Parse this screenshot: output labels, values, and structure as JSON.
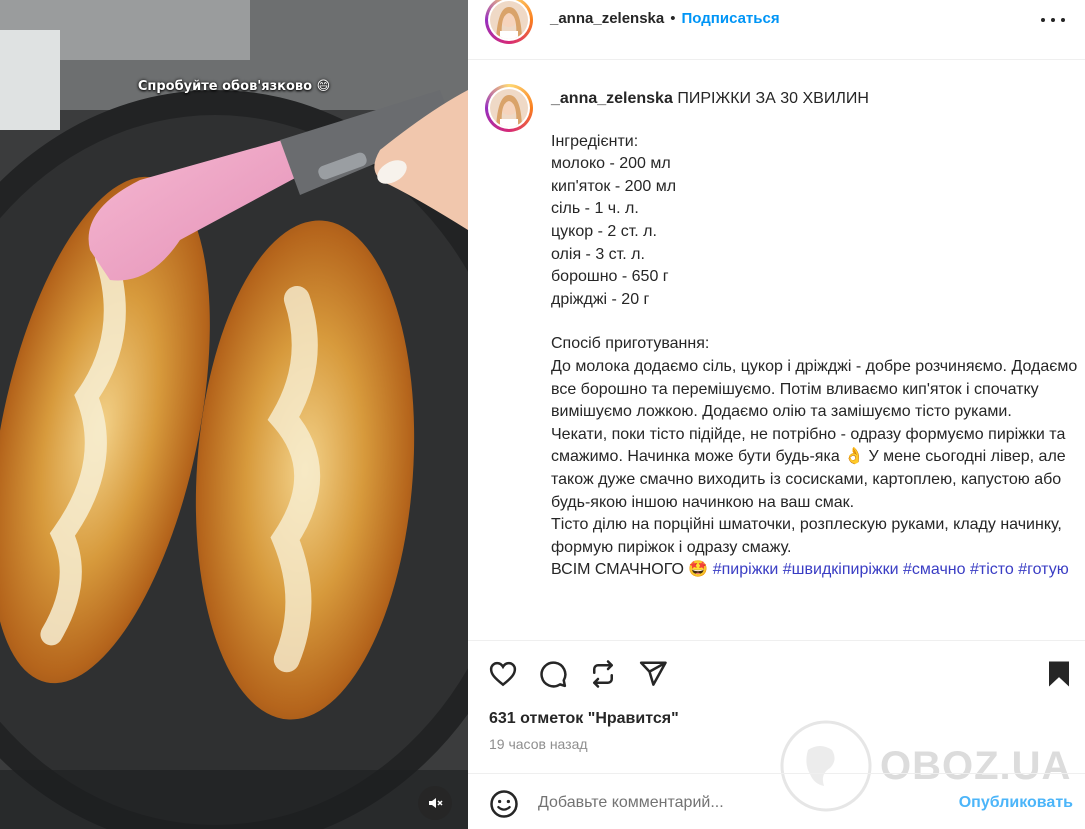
{
  "post": {
    "overlay_caption": "Спробуйте обов'язково 😄",
    "header": {
      "username": "_anna_zelenska",
      "separator": "•",
      "follow_label": "Подписаться"
    },
    "caption": {
      "username": "_anna_zelenska",
      "title": "ПИРІЖКИ ЗА 30 ХВИЛИН",
      "ingredients_heading": "Інгредієнти:",
      "ingredients": [
        "молоко - 200 мл",
        "кип'яток - 200 мл",
        "сіль - 1 ч. л.",
        "цукор - 2 ст. л.",
        "олія - 3 ст. л.",
        "борошно - 650 г",
        "дріжджі - 20 г"
      ],
      "method_heading": "Спосіб приготування:",
      "method": [
        "До молока додаємо сіль, цукор і дріжджі - добре розчиняємо. Додаємо все борошно та перемішуємо. Потім вливаємо кип'яток і спочатку вимішуємо ложкою. Додаємо олію та замішуємо тісто руками.",
        "Чекати, поки тісто підійде, не потрібно - одразу формуємо пиріжки та смажимо. Начинка може бути будь-яка 👌 У мене сьогодні лівер, але також дуже смачно виходить із сосисками, картоплею, капустою або будь-якою іншою начинкою на ваш смак.",
        "Тісто ділю на порційні шматочки, розплескую руками, кладу начинку, формую пиріжок і одразу смажу."
      ],
      "sign_off": "ВСІМ СМАЧНОГО 🤩",
      "hashtags": [
        "#пиріжки",
        "#швидкіпиріжки",
        "#смачно",
        "#тісто",
        "#готую"
      ]
    },
    "likes": "631 отметок \"Нравится\"",
    "time_ago": "19 часов назад",
    "comment": {
      "placeholder": "Добавьте комментарий...",
      "publish_label": "Опубликовать"
    },
    "watermark": "OBOZ.UA",
    "icons": {
      "like": "heart-icon",
      "comment": "comment-icon",
      "share": "repost-icon",
      "send": "send-icon",
      "save": "bookmark-icon",
      "emoji": "emoji-icon",
      "mute": "muted-speaker-icon",
      "more": "more-options-icon"
    },
    "colors": {
      "follow": "#0095f6",
      "publish": "#4cb5f9",
      "hashtag": "#3a3dc4",
      "text": "#262626",
      "muted": "#8e8e8e"
    }
  }
}
